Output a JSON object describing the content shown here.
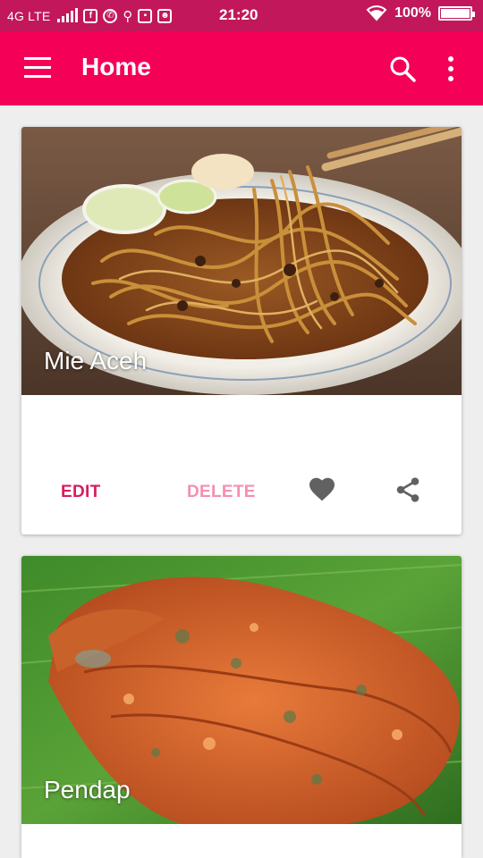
{
  "status_bar": {
    "network": "4G LTE",
    "time": "21:20",
    "battery": "100%",
    "battery_level": 1.0,
    "notification_icons": [
      "facebook-icon",
      "whatsapp-icon",
      "usb-icon",
      "app-icon",
      "chat-icon"
    ]
  },
  "app_bar": {
    "title": "Home",
    "icons": [
      "menu-icon",
      "search-icon",
      "more-vert-icon"
    ]
  },
  "cards": [
    {
      "title": "Mie Aceh",
      "edit_label": "EDIT",
      "delete_label": "DELETE"
    },
    {
      "title": "Pendap"
    }
  ],
  "colors": {
    "status_bar": "#c2185b",
    "app_bar": "#f50057",
    "edit": "#d81b60",
    "delete": "#f48fb1",
    "action_icon": "#616161"
  }
}
